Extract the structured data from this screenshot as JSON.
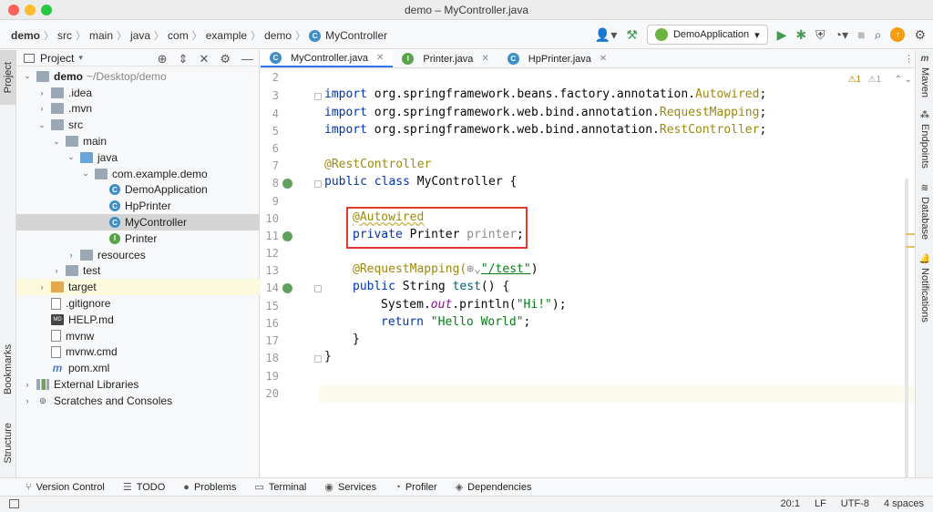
{
  "window": {
    "title": "demo – MyController.java"
  },
  "breadcrumbs": [
    "demo",
    "src",
    "main",
    "java",
    "com",
    "example",
    "demo",
    "MyController"
  ],
  "toolbar": {
    "run_config": "DemoApplication",
    "update_badge": "↑"
  },
  "left_strip": {
    "project": "Project",
    "bookmarks": "Bookmarks",
    "structure": "Structure"
  },
  "right_strip": {
    "maven": "Maven",
    "endpoints": "Endpoints",
    "database": "Database",
    "notifications": "Notifications"
  },
  "project_panel": {
    "title": "Project",
    "tree": [
      {
        "label": "demo",
        "suffix": "~/Desktop/demo",
        "indent": 0,
        "arrow": "open",
        "icon": "folder"
      },
      {
        "label": ".idea",
        "indent": 1,
        "arrow": "closed",
        "icon": "folder"
      },
      {
        "label": ".mvn",
        "indent": 1,
        "arrow": "closed",
        "icon": "folder"
      },
      {
        "label": "src",
        "indent": 1,
        "arrow": "open",
        "icon": "folder"
      },
      {
        "label": "main",
        "indent": 2,
        "arrow": "open",
        "icon": "folder"
      },
      {
        "label": "java",
        "indent": 3,
        "arrow": "open",
        "icon": "folder-blue"
      },
      {
        "label": "com.example.demo",
        "indent": 4,
        "arrow": "open",
        "icon": "folder"
      },
      {
        "label": "DemoApplication",
        "indent": 5,
        "arrow": "none",
        "icon": "class"
      },
      {
        "label": "HpPrinter",
        "indent": 5,
        "arrow": "none",
        "icon": "class"
      },
      {
        "label": "MyController",
        "indent": 5,
        "arrow": "none",
        "icon": "class",
        "selected": true
      },
      {
        "label": "Printer",
        "indent": 5,
        "arrow": "none",
        "icon": "interface"
      },
      {
        "label": "resources",
        "indent": 3,
        "arrow": "closed",
        "icon": "folder"
      },
      {
        "label": "test",
        "indent": 2,
        "arrow": "closed",
        "icon": "folder"
      },
      {
        "label": "target",
        "indent": 1,
        "arrow": "closed",
        "icon": "folder-orange",
        "highlight": true
      },
      {
        "label": ".gitignore",
        "indent": 1,
        "arrow": "none",
        "icon": "file"
      },
      {
        "label": "HELP.md",
        "indent": 1,
        "arrow": "none",
        "icon": "md"
      },
      {
        "label": "mvnw",
        "indent": 1,
        "arrow": "none",
        "icon": "file"
      },
      {
        "label": "mvnw.cmd",
        "indent": 1,
        "arrow": "none",
        "icon": "file"
      },
      {
        "label": "pom.xml",
        "indent": 1,
        "arrow": "none",
        "icon": "maven"
      },
      {
        "label": "External Libraries",
        "indent": 0,
        "arrow": "closed",
        "icon": "lib"
      },
      {
        "label": "Scratches and Consoles",
        "indent": 0,
        "arrow": "closed",
        "icon": "scratch"
      }
    ]
  },
  "tabs": [
    {
      "label": "MyController.java",
      "icon": "C",
      "active": true
    },
    {
      "label": "Printer.java",
      "icon": "I",
      "active": false
    },
    {
      "label": "HpPrinter.java",
      "icon": "C",
      "active": false
    }
  ],
  "editor": {
    "warnings": {
      "warn1": "1",
      "warn2": "1"
    },
    "line_numbers": [
      "2",
      "3",
      "4",
      "5",
      "6",
      "7",
      "8",
      "9",
      "10",
      "11",
      "12",
      "13",
      "14",
      "15",
      "16",
      "17",
      "18",
      "19",
      "20"
    ],
    "code": {
      "l3_kw": "import",
      "l3_pkg": " org.springframework.beans.factory.annotation.",
      "l3_cls": "Autowired",
      "l3_end": ";",
      "l4_kw": "import",
      "l4_pkg": " org.springframework.web.bind.annotation.",
      "l4_cls": "RequestMapping",
      "l4_end": ";",
      "l5_kw": "import",
      "l5_pkg": " org.springframework.web.bind.annotation.",
      "l5_cls": "RestController",
      "l5_end": ";",
      "l7_ann": "@RestController",
      "l8_kw": "public class",
      "l8_rest": " MyController {",
      "l10_ann": "@Autowired",
      "l11_kw": "private",
      "l11_type": " Printer ",
      "l11_fld": "printer",
      "l11_end": ";",
      "l13_ann": "@RequestMapping(",
      "l13_str": "\"/test\"",
      "l13_end": ")",
      "l14_kw": "public",
      "l14_type": " String ",
      "l14_mth": "test",
      "l14_end": "() {",
      "l15_a": "System.",
      "l15_out": "out",
      "l15_b": ".println(",
      "l15_str": "\"Hi!\"",
      "l15_end": ");",
      "l16_kw": "return",
      "l16_str": " \"Hello World\"",
      "l16_end": ";",
      "l17": "}",
      "l18": "}"
    }
  },
  "bottom_tools": [
    "Version Control",
    "TODO",
    "Problems",
    "Terminal",
    "Services",
    "Profiler",
    "Dependencies"
  ],
  "status": {
    "position": "20:1",
    "line_sep": "LF",
    "encoding": "UTF-8",
    "indent": "4 spaces"
  }
}
